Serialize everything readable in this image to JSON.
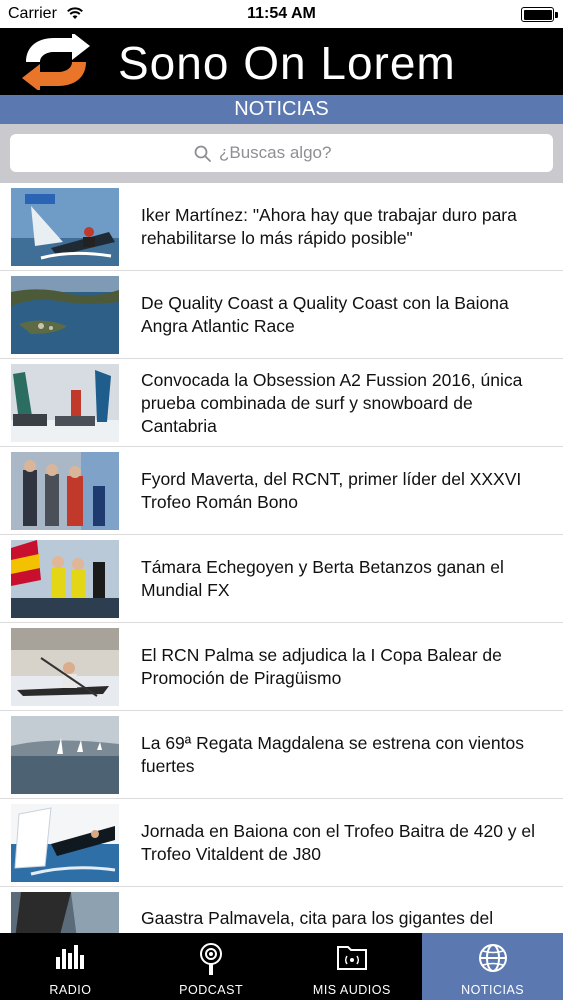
{
  "status_bar": {
    "carrier": "Carrier",
    "time": "11:54 AM"
  },
  "header": {
    "title": "Sono On Lorem",
    "logo_icon": "refresh-arrows-icon",
    "logo_colors": {
      "white": "#ffffff",
      "orange": "#e8752a"
    }
  },
  "section": {
    "title": "NOTICIAS"
  },
  "search": {
    "placeholder": "¿Buscas algo?"
  },
  "news": {
    "items": [
      {
        "headline": "Iker Martínez: \"Ahora hay que trabajar duro para rehabilitarse lo más rápido posible\"",
        "thumb": "sailing-catamaran-photo"
      },
      {
        "headline": "De Quality Coast a Quality Coast con la Baiona Angra Atlantic Race",
        "thumb": "aerial-coast-photo"
      },
      {
        "headline": "Convocada la Obsession A2 Fussion 2016, única prueba combinada de surf y snowboard de Cantabria",
        "thumb": "snow-event-photo"
      },
      {
        "headline": "Fyord Maverta, del RCNT, primer líder del XXXVI Trofeo Román Bono",
        "thumb": "award-ceremony-photo"
      },
      {
        "headline": "Támara Echegoyen y Berta Betanzos ganan el Mundial FX",
        "thumb": "sailors-celebrating-photo"
      },
      {
        "headline": "El RCN Palma se adjudica la I Copa Balear de Promoción de Piragüismo",
        "thumb": "canoe-photo"
      },
      {
        "headline": "La 69ª Regata Magdalena se estrena con vientos fuertes",
        "thumb": "regatta-fleet-photo"
      },
      {
        "headline": "Jornada en Baiona con el Trofeo Baitra de 420 y el Trofeo Vitaldent de J80",
        "thumb": "dinghy-sailing-photo"
      },
      {
        "headline": "Gaastra Palmavela, cita para los gigantes del",
        "thumb": "sail-closeup-photo"
      }
    ]
  },
  "tab_bar": {
    "accent": "#5b79b0",
    "tabs": [
      {
        "label": "RADIO",
        "icon": "equalizer-icon"
      },
      {
        "label": "PODCAST",
        "icon": "podcast-microphone-icon"
      },
      {
        "label": "MIS AUDIOS",
        "icon": "audio-folder-icon"
      },
      {
        "label": "NOTICIAS",
        "icon": "globe-icon",
        "active": true
      }
    ]
  }
}
